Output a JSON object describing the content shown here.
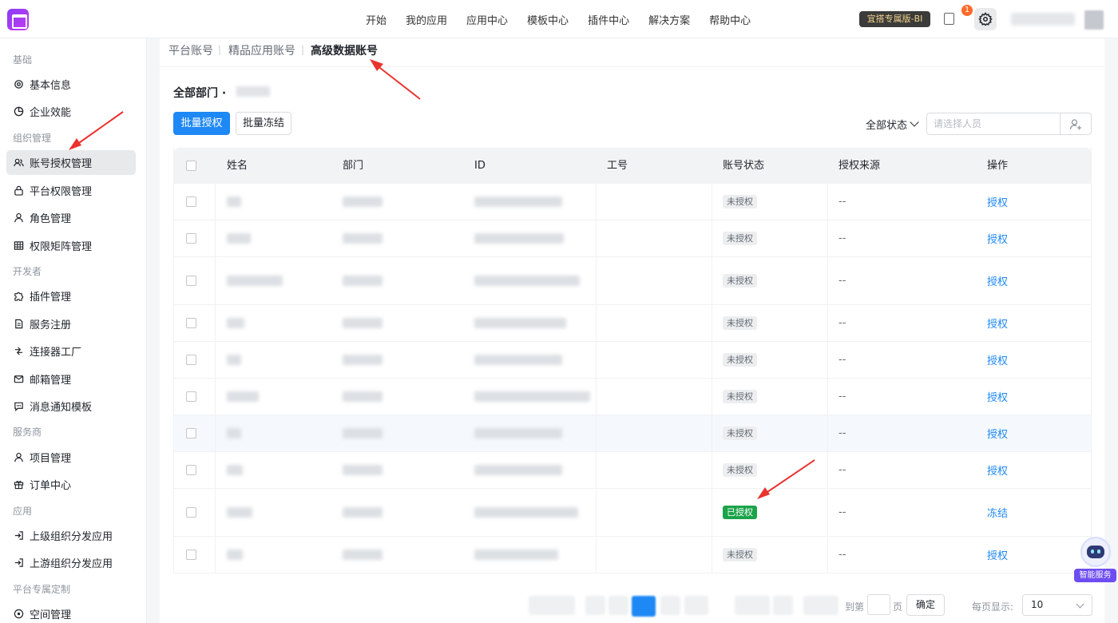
{
  "topnav": [
    "开始",
    "我的应用",
    "应用中心",
    "模板中心",
    "插件中心",
    "解决方案",
    "帮助中心"
  ],
  "header": {
    "bi_badge": "宜搭专属版-BI",
    "notification_count": "1"
  },
  "sidebar": {
    "sections": [
      {
        "title": "基础",
        "items": [
          "基本信息",
          "企业效能"
        ]
      },
      {
        "title": "组织管理",
        "items": [
          "账号授权管理",
          "平台权限管理",
          "角色管理",
          "权限矩阵管理"
        ]
      },
      {
        "title": "开发者",
        "items": [
          "插件管理",
          "服务注册",
          "连接器工厂",
          "邮箱管理",
          "消息通知模板"
        ]
      },
      {
        "title": "服务商",
        "items": [
          "项目管理",
          "订单中心"
        ]
      },
      {
        "title": "应用",
        "items": [
          "上级组织分发应用",
          "上游组织分发应用"
        ]
      },
      {
        "title": "平台专属定制",
        "items": [
          "空间管理"
        ]
      }
    ],
    "active_item": "账号授权管理"
  },
  "tabs": [
    "平台账号",
    "精品应用账号",
    "高级数据账号"
  ],
  "active_tab": "高级数据账号",
  "dept_title": "全部部门 ·",
  "toolbar": {
    "batch_authorize": "批量授权",
    "batch_freeze": "批量冻结",
    "status_filter": "全部状态",
    "person_placeholder": "请选择人员"
  },
  "table": {
    "columns": [
      "姓名",
      "部门",
      "ID",
      "工号",
      "账号状态",
      "授权来源",
      "操作"
    ],
    "rows": [
      {
        "status": "未授权",
        "source": "--",
        "action": "授权",
        "authorized": false
      },
      {
        "status": "未授权",
        "source": "--",
        "action": "授权",
        "authorized": false
      },
      {
        "status": "未授权",
        "source": "--",
        "action": "授权",
        "authorized": false
      },
      {
        "status": "未授权",
        "source": "--",
        "action": "授权",
        "authorized": false
      },
      {
        "status": "未授权",
        "source": "--",
        "action": "授权",
        "authorized": false
      },
      {
        "status": "未授权",
        "source": "--",
        "action": "授权",
        "authorized": false
      },
      {
        "status": "未授权",
        "source": "--",
        "action": "授权",
        "authorized": false
      },
      {
        "status": "未授权",
        "source": "--",
        "action": "授权",
        "authorized": false
      },
      {
        "status": "已授权",
        "source": "--",
        "action": "冻结",
        "authorized": true
      },
      {
        "status": "未授权",
        "source": "--",
        "action": "授权",
        "authorized": false
      }
    ]
  },
  "pagination": {
    "goto_label": "到第",
    "page_unit": "页",
    "confirm": "确定",
    "per_page_label": "每页显示:",
    "per_page_value": "10"
  },
  "assistant": {
    "label": "智能服务"
  },
  "colors": {
    "primary": "#1e88f5",
    "authorized_tag": "#1aa34a",
    "annotation_arrow": "#e8332f"
  }
}
